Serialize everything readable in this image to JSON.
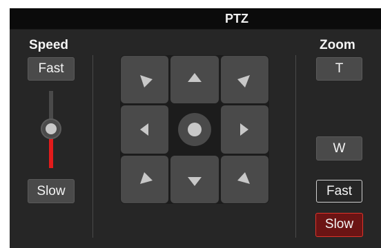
{
  "panel": {
    "title": "PTZ"
  },
  "speed": {
    "label": "Speed",
    "fast_label": "Fast",
    "slow_label": "Slow",
    "level": 0.45
  },
  "zoom": {
    "label": "Zoom",
    "tele_label": "T",
    "wide_label": "W",
    "speed_fast_label": "Fast",
    "speed_slow_label": "Slow",
    "selected_speed": "Slow"
  },
  "dpad": {
    "icons": [
      "arrow-down-right-icon",
      "arrow-up-icon",
      "arrow-down-left-icon",
      "arrow-left-icon",
      "home-icon",
      "arrow-right-icon",
      "arrow-up-right-icon",
      "arrow-down-icon",
      "arrow-up-left-icon"
    ]
  },
  "colors": {
    "panel_bg": "#262626",
    "button_bg": "#4a4a4a",
    "accent_red": "#e21b1b",
    "glyph": "#c8c8c8"
  }
}
